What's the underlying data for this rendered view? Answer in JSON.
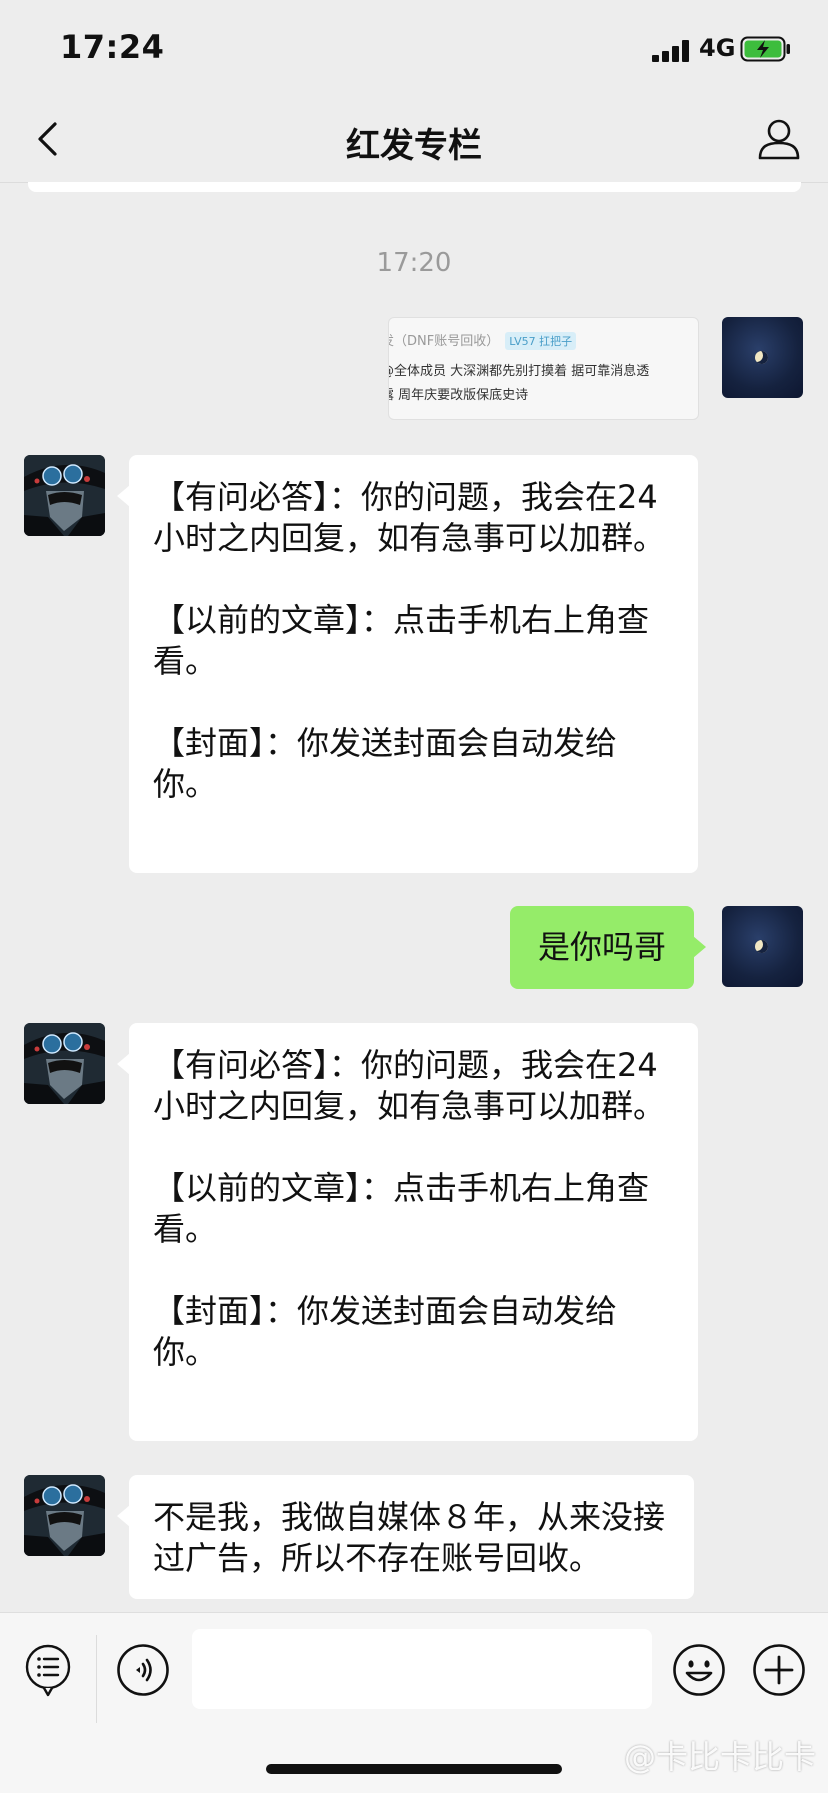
{
  "status_bar": {
    "time": "17:24",
    "network": "4G"
  },
  "nav": {
    "title": "红发专栏"
  },
  "chat": {
    "timestamp": "17:20",
    "quoted_card": {
      "line1": "发（DNF账号回收）",
      "badge": "LV57 扛把子",
      "line2": "@全体成员 大深渊都先别打摸着 据可靠消息透",
      "line3": "露 周年庆要改版保底史诗"
    },
    "auto_reply_1": {
      "p1": "【有问必答】：你的问题，我会在24小时之内回复，如有急事可以加群。",
      "p2": "【以前的文章】：点击手机右上角查看。",
      "p3": "【封面】：你发送封面会自动发给你。"
    },
    "my_message": "是你吗哥",
    "auto_reply_2": {
      "p1": "【有问必答】：你的问题，我会在24小时之内回复，如有急事可以加群。",
      "p2": "【以前的文章】：点击手机右上角查看。",
      "p3": "【封面】：你发送封面会自动发给你。"
    },
    "reply_message": "不是我，我做自媒体８年，从来没接过广告，所以不存在账号回收。"
  },
  "input": {
    "value": "",
    "placeholder": ""
  },
  "watermark": "@卡比卡比卡",
  "colors": {
    "background": "#ededed",
    "bubble_self": "#95ec69",
    "bubble_other": "#ffffff"
  },
  "icons": {
    "back": "chevron-left-icon",
    "profile": "person-icon",
    "menu": "list-icon",
    "voice": "voice-icon",
    "emoji": "smiley-icon",
    "plus": "plus-icon"
  }
}
